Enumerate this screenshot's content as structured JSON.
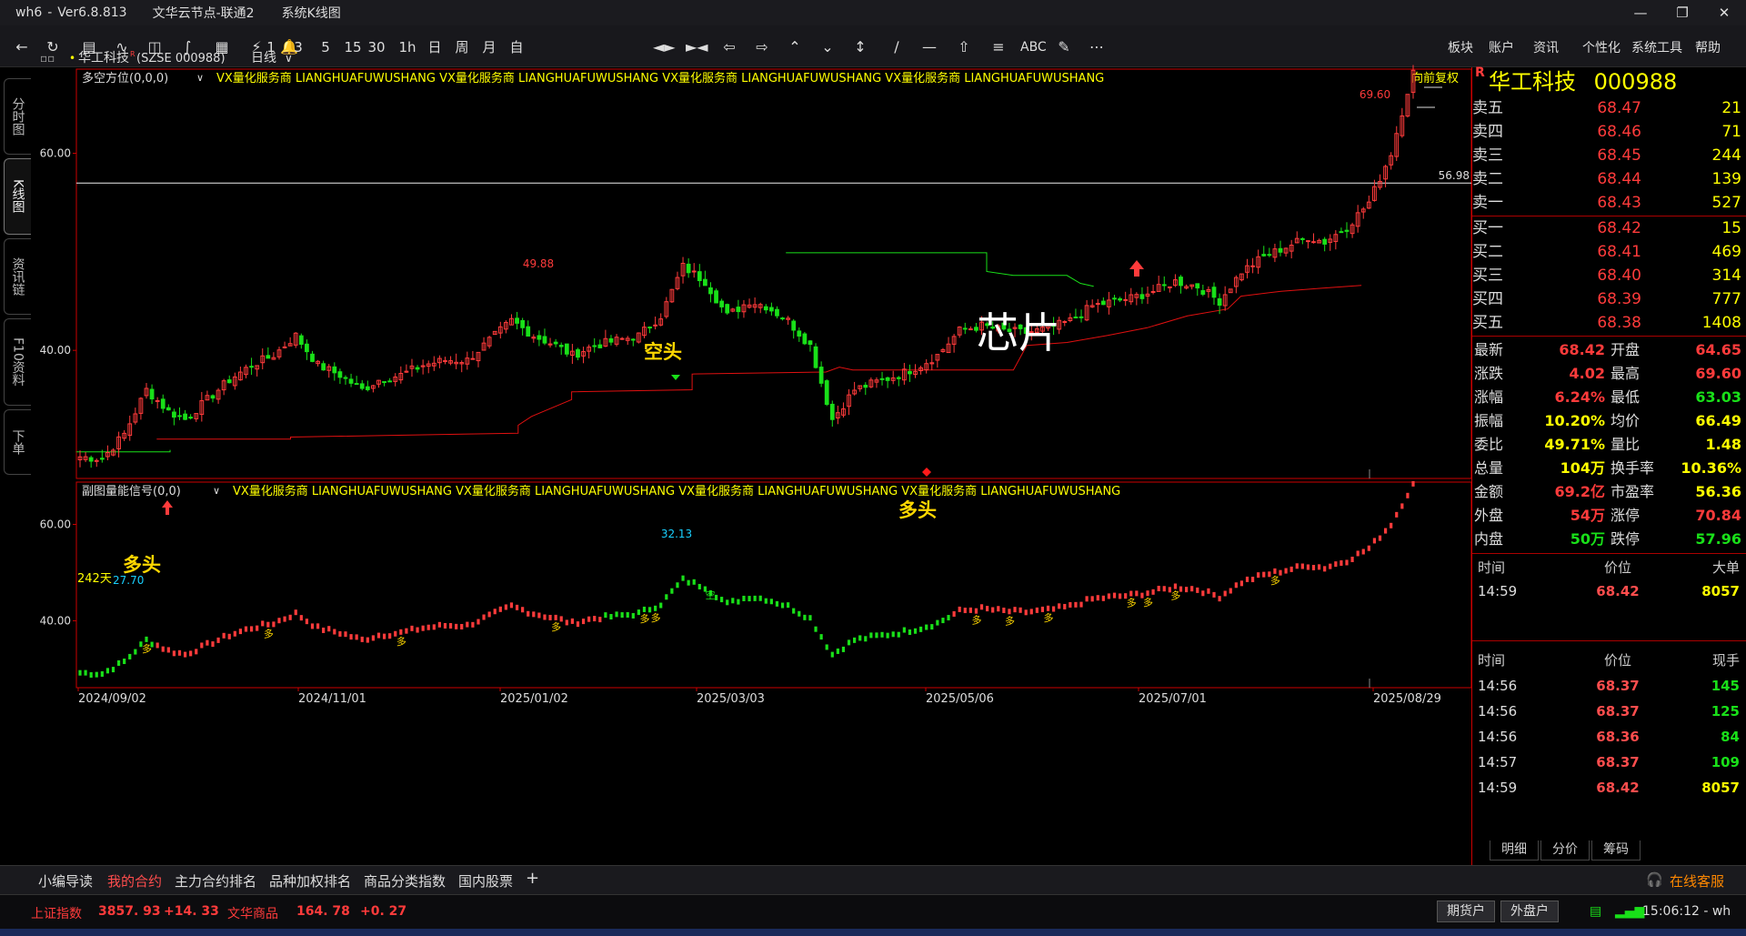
{
  "window": {
    "app": "wh6",
    "version": "Ver6.8.813",
    "node": "文华云节点-联通2",
    "view": "系统K线图"
  },
  "toolbar": {
    "periods": [
      "1",
      "3",
      "5",
      "15",
      "30",
      "1h",
      "日",
      "周",
      "月",
      "自"
    ],
    "text_tools": [
      "ABC"
    ],
    "menu": [
      "板块",
      "账户",
      "资讯",
      "个性化",
      "系统工具",
      "帮助"
    ]
  },
  "leftrail": {
    "tabs": [
      "分时图",
      "K线图",
      "资讯链",
      "F10资料",
      "下单"
    ]
  },
  "chart": {
    "symbol": "华工科技",
    "code": "(SZSE 000988)",
    "period": "日线",
    "main_indicator": "多空方位(0,0,0)",
    "sub_indicator": "副图量能信号(0,0)",
    "watermark": "VX量化服务商  LIANGHUAFUWUSHANG  VX量化服务商  LIANGHUAFUWUSHANG  VX量化服务商  LIANGHUAFUWUSHANG  VX量化服务商  LIANGHUAFUWUSHANG",
    "adjust": "向前复权",
    "r_mark": "R",
    "main_yticks": [
      "60.00",
      "40.00"
    ],
    "sub_yticks": [
      "60.00",
      "40.00"
    ],
    "xticks": [
      "2024/09/02",
      "2024/11/01",
      "2025/01/02",
      "2025/03/03",
      "2025/05/06",
      "2025/07/01",
      "2025/08/29"
    ],
    "high_label": "69.60",
    "peak_label": "49.88",
    "low_label": "32.13",
    "start_low_label": "27.70",
    "hline_label": "56.98",
    "days_label": "242天",
    "annotations": {
      "long1": "多头",
      "short1": "空头",
      "long2": "多头",
      "theme": "芯片"
    },
    "signal_long": "多",
    "signal_short": "空"
  },
  "chart_data": {
    "type": "candlestick",
    "x_range": [
      "2024/09/02",
      "2025/08/29"
    ],
    "ylim": [
      25,
      72
    ],
    "labeled_points": [
      {
        "label": "27.70",
        "value": 27.7
      },
      {
        "label": "49.88",
        "value": 49.88
      },
      {
        "label": "32.13",
        "value": 32.13
      },
      {
        "label": "69.60",
        "value": 69.6
      }
    ],
    "reference_line": 56.98,
    "close_path": [
      [
        "2024/09/02",
        29.2
      ],
      [
        "2024/09/20",
        29.0
      ],
      [
        "2024/09/27",
        31.5
      ],
      [
        "2024/10/08",
        36.0
      ],
      [
        "2024/10/15",
        33.8
      ],
      [
        "2024/10/22",
        33.0
      ],
      [
        "2024/10/28",
        35.0
      ],
      [
        "2024/11/01",
        37.0
      ],
      [
        "2024/11/07",
        38.5
      ],
      [
        "2024/11/13",
        39.5
      ],
      [
        "2024/11/19",
        41.5
      ],
      [
        "2024/11/22",
        38.5
      ],
      [
        "2024/11/28",
        37.5
      ],
      [
        "2024/12/04",
        36.0
      ],
      [
        "2024/12/10",
        37.0
      ],
      [
        "2024/12/16",
        37.5
      ],
      [
        "2024/12/20",
        38.5
      ],
      [
        "2024/12/26",
        39.0
      ],
      [
        "2025/01/02",
        39.0
      ],
      [
        "2025/01/08",
        41.0
      ],
      [
        "2025/01/13",
        43.0
      ],
      [
        "2025/01/17",
        41.5
      ],
      [
        "2025/01/23",
        40.5
      ],
      [
        "2025/02/05",
        39.5
      ],
      [
        "2025/02/11",
        40.5
      ],
      [
        "2025/02/17",
        41.0
      ],
      [
        "2025/02/21",
        41.5
      ],
      [
        "2025/02/26",
        43.5
      ],
      [
        "2025/03/03",
        48.5
      ],
      [
        "2025/03/06",
        47.0
      ],
      [
        "2025/03/12",
        43.5
      ],
      [
        "2025/03/18",
        45.0
      ],
      [
        "2025/03/24",
        44.5
      ],
      [
        "2025/03/28",
        43.0
      ],
      [
        "2025/04/03",
        40.5
      ],
      [
        "2025/04/07",
        33.0
      ],
      [
        "2025/04/11",
        36.0
      ],
      [
        "2025/04/17",
        36.8
      ],
      [
        "2025/04/23",
        37.5
      ],
      [
        "2025/04/29",
        38.5
      ],
      [
        "2025/05/06",
        39.5
      ],
      [
        "2025/05/12",
        42.0
      ],
      [
        "2025/05/16",
        42.5
      ],
      [
        "2025/05/22",
        42.0
      ],
      [
        "2025/05/28",
        41.8
      ],
      [
        "2025/06/04",
        42.2
      ],
      [
        "2025/06/10",
        43.0
      ],
      [
        "2025/06/16",
        44.5
      ],
      [
        "2025/06/20",
        45.0
      ],
      [
        "2025/06/26",
        45.3
      ],
      [
        "2025/07/01",
        46.0
      ],
      [
        "2025/07/07",
        47.0
      ],
      [
        "2025/07/11",
        46.5
      ],
      [
        "2025/07/17",
        45.0
      ],
      [
        "2025/07/23",
        48.0
      ],
      [
        "2025/07/29",
        49.5
      ],
      [
        "2025/08/04",
        50.5
      ],
      [
        "2025/08/08",
        51.5
      ],
      [
        "2025/08/14",
        51.0
      ],
      [
        "2025/08/18",
        52.5
      ],
      [
        "2025/08/22",
        55.0
      ],
      [
        "2025/08/26",
        60.0
      ],
      [
        "2025/08/29",
        68.42
      ]
    ]
  },
  "quote": {
    "name": "华工科技",
    "code": "000988",
    "sell": [
      {
        "label": "卖五",
        "price": "68.47",
        "vol": "21"
      },
      {
        "label": "卖四",
        "price": "68.46",
        "vol": "71"
      },
      {
        "label": "卖三",
        "price": "68.45",
        "vol": "244"
      },
      {
        "label": "卖二",
        "price": "68.44",
        "vol": "139"
      },
      {
        "label": "卖一",
        "price": "68.43",
        "vol": "527"
      }
    ],
    "buy": [
      {
        "label": "买一",
        "price": "68.42",
        "vol": "15"
      },
      {
        "label": "买二",
        "price": "68.41",
        "vol": "469"
      },
      {
        "label": "买三",
        "price": "68.40",
        "vol": "314"
      },
      {
        "label": "买四",
        "price": "68.39",
        "vol": "777"
      },
      {
        "label": "买五",
        "price": "68.38",
        "vol": "1408"
      }
    ],
    "stats": [
      {
        "k": "最新",
        "v": "68.42",
        "k2": "开盘",
        "v2": "64.65"
      },
      {
        "k": "涨跌",
        "v": "4.02",
        "k2": "最高",
        "v2": "69.60"
      },
      {
        "k": "涨幅",
        "v": "6.24%",
        "k2": "最低",
        "v2": "63.03"
      },
      {
        "k": "振幅",
        "v": "10.20%",
        "k2": "均价",
        "v2": "66.49"
      },
      {
        "k": "委比",
        "v": "49.71%",
        "k2": "量比",
        "v2": "1.48"
      },
      {
        "k": "总量",
        "v": "104万",
        "k2": "换手率",
        "v2": "10.36%"
      },
      {
        "k": "金额",
        "v": "69.2亿",
        "k2": "市盈率",
        "v2": "56.36"
      },
      {
        "k": "外盘",
        "v": "54万",
        "k2": "涨停",
        "v2": "70.84"
      },
      {
        "k": "内盘",
        "v": "50万",
        "k2": "跌停",
        "v2": "57.96"
      }
    ],
    "big_header": {
      "a": "时间",
      "b": "价位",
      "c": "大单"
    },
    "big_rows": [
      {
        "t": "14:59",
        "p": "68.42",
        "v": "8057"
      }
    ],
    "tick_header": {
      "a": "时间",
      "b": "价位",
      "c": "现手"
    },
    "tick_rows": [
      {
        "t": "14:56",
        "p": "68.37",
        "v": "145"
      },
      {
        "t": "14:56",
        "p": "68.37",
        "v": "125"
      },
      {
        "t": "14:56",
        "p": "68.36",
        "v": "84"
      },
      {
        "t": "14:57",
        "p": "68.37",
        "v": "109"
      },
      {
        "t": "14:59",
        "p": "68.42",
        "v": "8057"
      }
    ],
    "tabs": [
      "明细",
      "分价",
      "筹码"
    ]
  },
  "tabbar": {
    "tabs": [
      "小编导读",
      "我的合约",
      "主力合约排名",
      "品种加权排名",
      "商品分类指数",
      "国内股票"
    ],
    "add": "+",
    "service": "在线客服"
  },
  "statusbar": {
    "idx1_name": "上证指数",
    "idx1_value": "3857. 93",
    "idx1_change": "+14. 33",
    "idx2_name": "文华商品",
    "idx2_value": "164. 78",
    "idx2_change": "+0. 27",
    "btn_futures": "期货户",
    "btn_foreign": "外盘户",
    "time": "15:06:12 - wh"
  },
  "colors": {
    "up": "#ff3b3b",
    "down": "#19e019",
    "label_yellow": "#ffff00",
    "annotation_gold": "#ffd700",
    "border_red": "#cc0000"
  }
}
